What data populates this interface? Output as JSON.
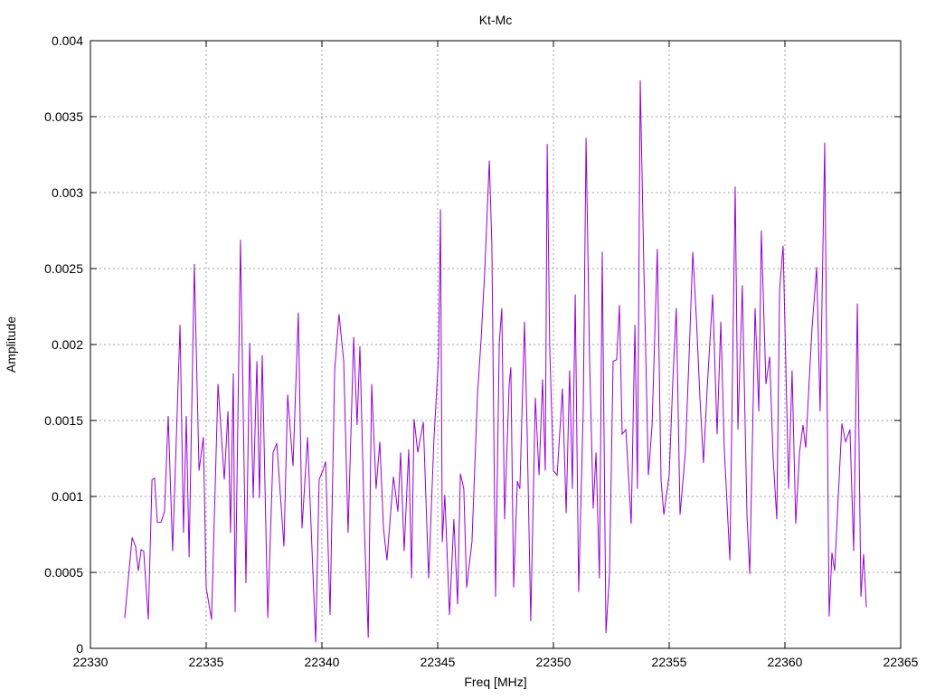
{
  "chart_data": {
    "type": "line",
    "title": "Kt-Mc",
    "xlabel": "Freq [MHz]",
    "ylabel": "Amplitude",
    "xlim": [
      22330,
      22365
    ],
    "ylim": [
      0,
      0.004
    ],
    "xticks": [
      "22330",
      "22335",
      "22340",
      "22345",
      "22350",
      "22355",
      "22360",
      "22365"
    ],
    "yticks": [
      "0",
      "0.0005",
      "0.001",
      "0.0015",
      "0.002",
      "0.0025",
      "0.003",
      "0.0035",
      "0.004"
    ],
    "grid": true,
    "series": [
      {
        "name": "Kt-Mc",
        "color": "#9400d3",
        "x": [
          22331.48,
          22331.8,
          22331.95,
          22332.07,
          22332.19,
          22332.3,
          22332.5,
          22332.66,
          22332.77,
          22332.89,
          22333.05,
          22333.2,
          22333.36,
          22333.55,
          22333.87,
          22334.02,
          22334.14,
          22334.26,
          22334.49,
          22334.69,
          22334.88,
          22335.0,
          22335.23,
          22335.51,
          22335.78,
          22335.94,
          22336.05,
          22336.17,
          22336.25,
          22336.48,
          22336.72,
          22336.88,
          22337.03,
          22337.19,
          22337.3,
          22337.42,
          22337.66,
          22337.89,
          22338.05,
          22338.36,
          22338.52,
          22338.75,
          22338.98,
          22339.14,
          22339.38,
          22339.73,
          22339.88,
          22340.04,
          22340.16,
          22340.35,
          22340.55,
          22340.74,
          22340.94,
          22341.13,
          22341.37,
          22341.52,
          22341.64,
          22341.84,
          22342.0,
          22342.15,
          22342.34,
          22342.5,
          22342.66,
          22342.81,
          22343.09,
          22343.28,
          22343.4,
          22343.55,
          22343.75,
          22343.87,
          22343.98,
          22344.14,
          22344.38,
          22344.61,
          22344.84,
          22345.04,
          22345.12,
          22345.2,
          22345.31,
          22345.51,
          22345.7,
          22345.86,
          22345.98,
          22346.13,
          22346.25,
          22346.48,
          22346.72,
          22346.88,
          22347.03,
          22347.23,
          22347.34,
          22347.5,
          22347.66,
          22347.77,
          22347.89,
          22348.09,
          22348.16,
          22348.28,
          22348.44,
          22348.55,
          22348.75,
          22348.86,
          22349.02,
          22349.22,
          22349.38,
          22349.53,
          22349.65,
          22349.73,
          22349.84,
          22350.0,
          22350.16,
          22350.39,
          22350.55,
          22350.7,
          22350.82,
          22350.94,
          22351.09,
          22351.29,
          22351.41,
          22351.56,
          22351.72,
          22351.84,
          22351.99,
          22352.11,
          22352.27,
          22352.42,
          22352.58,
          22352.73,
          22352.85,
          22352.97,
          22353.13,
          22353.36,
          22353.52,
          22353.63,
          22353.75,
          22353.91,
          22354.1,
          22354.26,
          22354.49,
          22354.65,
          22354.77,
          22355.0,
          22355.16,
          22355.31,
          22355.47,
          22355.7,
          22355.86,
          22356.02,
          22356.17,
          22356.33,
          22356.48,
          22356.64,
          22356.88,
          22357.07,
          22357.23,
          22357.38,
          22357.62,
          22357.85,
          22357.97,
          22358.16,
          22358.36,
          22358.48,
          22358.71,
          22358.87,
          22358.98,
          22359.18,
          22359.34,
          22359.49,
          22359.65,
          22359.77,
          22359.92,
          22360.16,
          22360.31,
          22360.47,
          22360.63,
          22360.78,
          22360.9,
          22361.05,
          22361.17,
          22361.37,
          22361.52,
          22361.72,
          22361.91,
          22362.03,
          22362.15,
          22362.3,
          22362.46,
          22362.62,
          22362.81,
          22362.97,
          22363.13,
          22363.28,
          22363.4,
          22363.52
        ],
        "y": [
          0.0002,
          0.00073,
          0.00067,
          0.00051,
          0.00065,
          0.00064,
          0.00019,
          0.00111,
          0.00112,
          0.00083,
          0.00083,
          0.0009,
          0.00153,
          0.00064,
          0.00213,
          0.00076,
          0.00153,
          0.0006,
          0.00253,
          0.00117,
          0.00139,
          0.0004,
          0.00019,
          0.00174,
          0.00111,
          0.00156,
          0.00076,
          0.00181,
          0.00024,
          0.00269,
          0.00043,
          0.00201,
          0.00099,
          0.00189,
          0.00099,
          0.00193,
          0.0002,
          0.00129,
          0.00135,
          0.00067,
          0.00167,
          0.0012,
          0.00221,
          0.00079,
          0.00139,
          4e-05,
          0.00111,
          0.00117,
          0.00123,
          0.00022,
          0.00183,
          0.0022,
          0.00189,
          0.00076,
          0.00205,
          0.00147,
          0.00199,
          0.00076,
          7e-05,
          0.00174,
          0.00105,
          0.00136,
          0.00079,
          0.00058,
          0.00113,
          0.0009,
          0.00129,
          0.00064,
          0.00131,
          0.00046,
          0.00151,
          0.00129,
          0.00149,
          0.00046,
          0.00138,
          0.00192,
          0.00289,
          0.0007,
          0.00101,
          0.00022,
          0.00085,
          0.00029,
          0.00115,
          0.00105,
          0.0004,
          0.0007,
          0.00167,
          0.00204,
          0.00248,
          0.00321,
          0.00266,
          0.00034,
          0.00201,
          0.00224,
          0.00085,
          0.00174,
          0.00185,
          0.0004,
          0.0011,
          0.00105,
          0.00215,
          0.00147,
          0.00018,
          0.00165,
          0.00114,
          0.00177,
          0.00117,
          0.00332,
          0.00198,
          0.00117,
          0.00114,
          0.00171,
          0.00089,
          0.00183,
          0.00105,
          0.00233,
          0.00037,
          0.00159,
          0.00336,
          0.00192,
          0.00092,
          0.00129,
          0.00046,
          0.00261,
          0.0001,
          0.00049,
          0.00189,
          0.0019,
          0.00226,
          0.00141,
          0.00144,
          0.00082,
          0.00213,
          0.00105,
          0.00374,
          0.00248,
          0.00114,
          0.00147,
          0.00263,
          0.00111,
          0.00088,
          0.00114,
          0.00177,
          0.00224,
          0.00088,
          0.00129,
          0.00192,
          0.00261,
          0.00218,
          0.00165,
          0.00122,
          0.00171,
          0.00233,
          0.00141,
          0.00215,
          0.00132,
          0.00058,
          0.00304,
          0.00144,
          0.00239,
          0.00088,
          0.00049,
          0.00224,
          0.00156,
          0.00275,
          0.00174,
          0.00192,
          0.00126,
          0.00085,
          0.00236,
          0.00265,
          0.00105,
          0.00183,
          0.00082,
          0.00129,
          0.00147,
          0.00132,
          0.00177,
          0.00211,
          0.00251,
          0.00156,
          0.00333,
          0.00021,
          0.00063,
          0.00051,
          0.00099,
          0.00148,
          0.00136,
          0.00144,
          0.00064,
          0.00227,
          0.00034,
          0.00062,
          0.00027
        ]
      }
    ]
  }
}
